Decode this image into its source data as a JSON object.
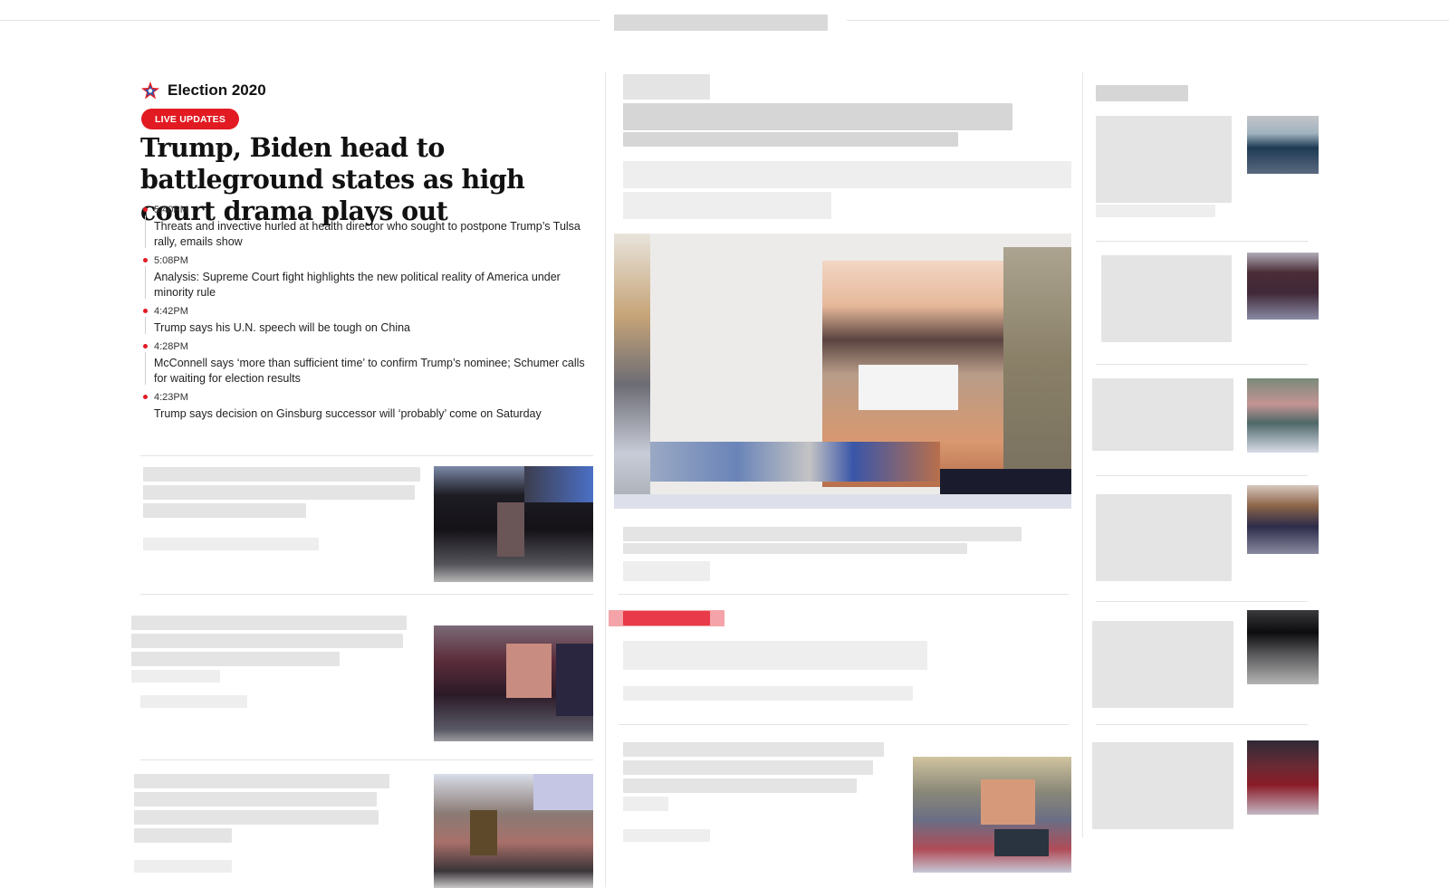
{
  "election": {
    "section_label": "Election 2020",
    "badge": "LIVE UPDATES",
    "headline": "Trump, Biden head to battleground states as high court drama plays out",
    "updates": [
      {
        "time": "5:40PM",
        "text": "Threats and invective hurled at health director who sought to postpone Trump’s Tulsa rally, emails show"
      },
      {
        "time": "5:08PM",
        "text": "Analysis: Supreme Court fight highlights the new political reality of America under minority rule"
      },
      {
        "time": "4:42PM",
        "text": "Trump says his U.N. speech will be tough on China"
      },
      {
        "time": "4:28PM",
        "text": "McConnell says ‘more than sufficient time’ to confirm Trump’s nominee; Schumer calls for waiting for election results"
      },
      {
        "time": "4:23PM",
        "text": "Trump says decision on Ginsburg successor will ‘probably’ come on Saturday"
      }
    ]
  },
  "colors": {
    "accent_red": "#e21a22",
    "text": "#111111",
    "divider": "#e3e3e3"
  },
  "icons": {
    "election_logo": "star-logo-icon"
  }
}
